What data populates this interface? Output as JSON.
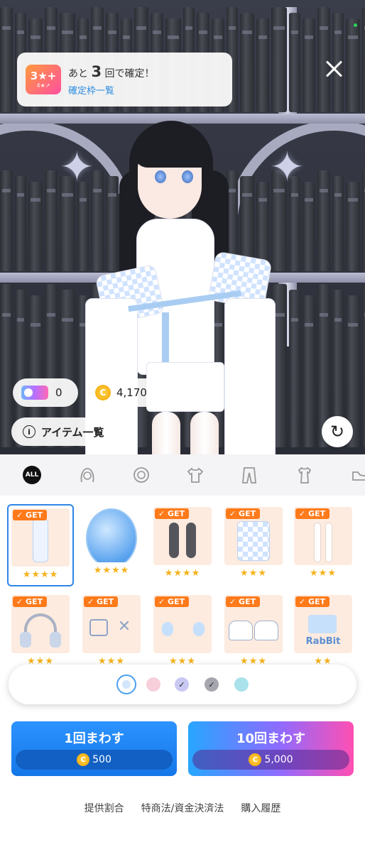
{
  "banner": {
    "badge_main": "3★+",
    "badge_sub": "4★↗",
    "text_prefix": "あと",
    "count": "3",
    "text_suffix": "回で確定！",
    "link": "確定枠一覧"
  },
  "currency": {
    "tickets": "0",
    "coin_symbol": "C",
    "coins": "4,170"
  },
  "items_button": {
    "info_glyph": "i",
    "label": "アイテム一覧"
  },
  "refresh_glyph": "↻",
  "tabs": {
    "all_label": "ALL",
    "icons": [
      "all-icon",
      "hair-icon",
      "accessory-icon",
      "top-icon",
      "bottom-icon",
      "outfit-icon",
      "shoes-icon"
    ]
  },
  "grid": {
    "row1": [
      {
        "badge": "✓ GET",
        "stars": "★★★★"
      },
      {
        "badge": "",
        "stars": "★★★★"
      },
      {
        "badge": "✓ GET",
        "stars": "★★★★"
      },
      {
        "badge": "✓ GET",
        "stars": "★★★"
      },
      {
        "badge": "✓ GET",
        "stars": "★★★"
      }
    ],
    "row2": [
      {
        "badge": "✓ GET",
        "stars": "★★★"
      },
      {
        "badge": "✓ GET",
        "stars": "★★★"
      },
      {
        "badge": "✓ GET",
        "stars": "★★★"
      },
      {
        "badge": "✓ GET",
        "stars": "★★★"
      },
      {
        "badge": "✓ GET",
        "stars": "★★"
      }
    ],
    "rabbit_text": "RabBit"
  },
  "colors": {
    "swatches": [
      {
        "color": "#d4e6fb",
        "selected": true
      },
      {
        "color": "#f7cfdb",
        "check": ""
      },
      {
        "color": "#c9c8f2",
        "check": "✓"
      },
      {
        "color": "#a6a6ae",
        "check": "✓"
      },
      {
        "color": "#a9e2ea",
        "check": ""
      }
    ]
  },
  "spin": {
    "one": {
      "label": "1回まわす",
      "cost": "500"
    },
    "ten": {
      "label": "10回まわす",
      "cost": "5,000"
    }
  },
  "footer": {
    "links": [
      "提供割合",
      "特商法/資金決済法",
      "購入履歴"
    ]
  }
}
